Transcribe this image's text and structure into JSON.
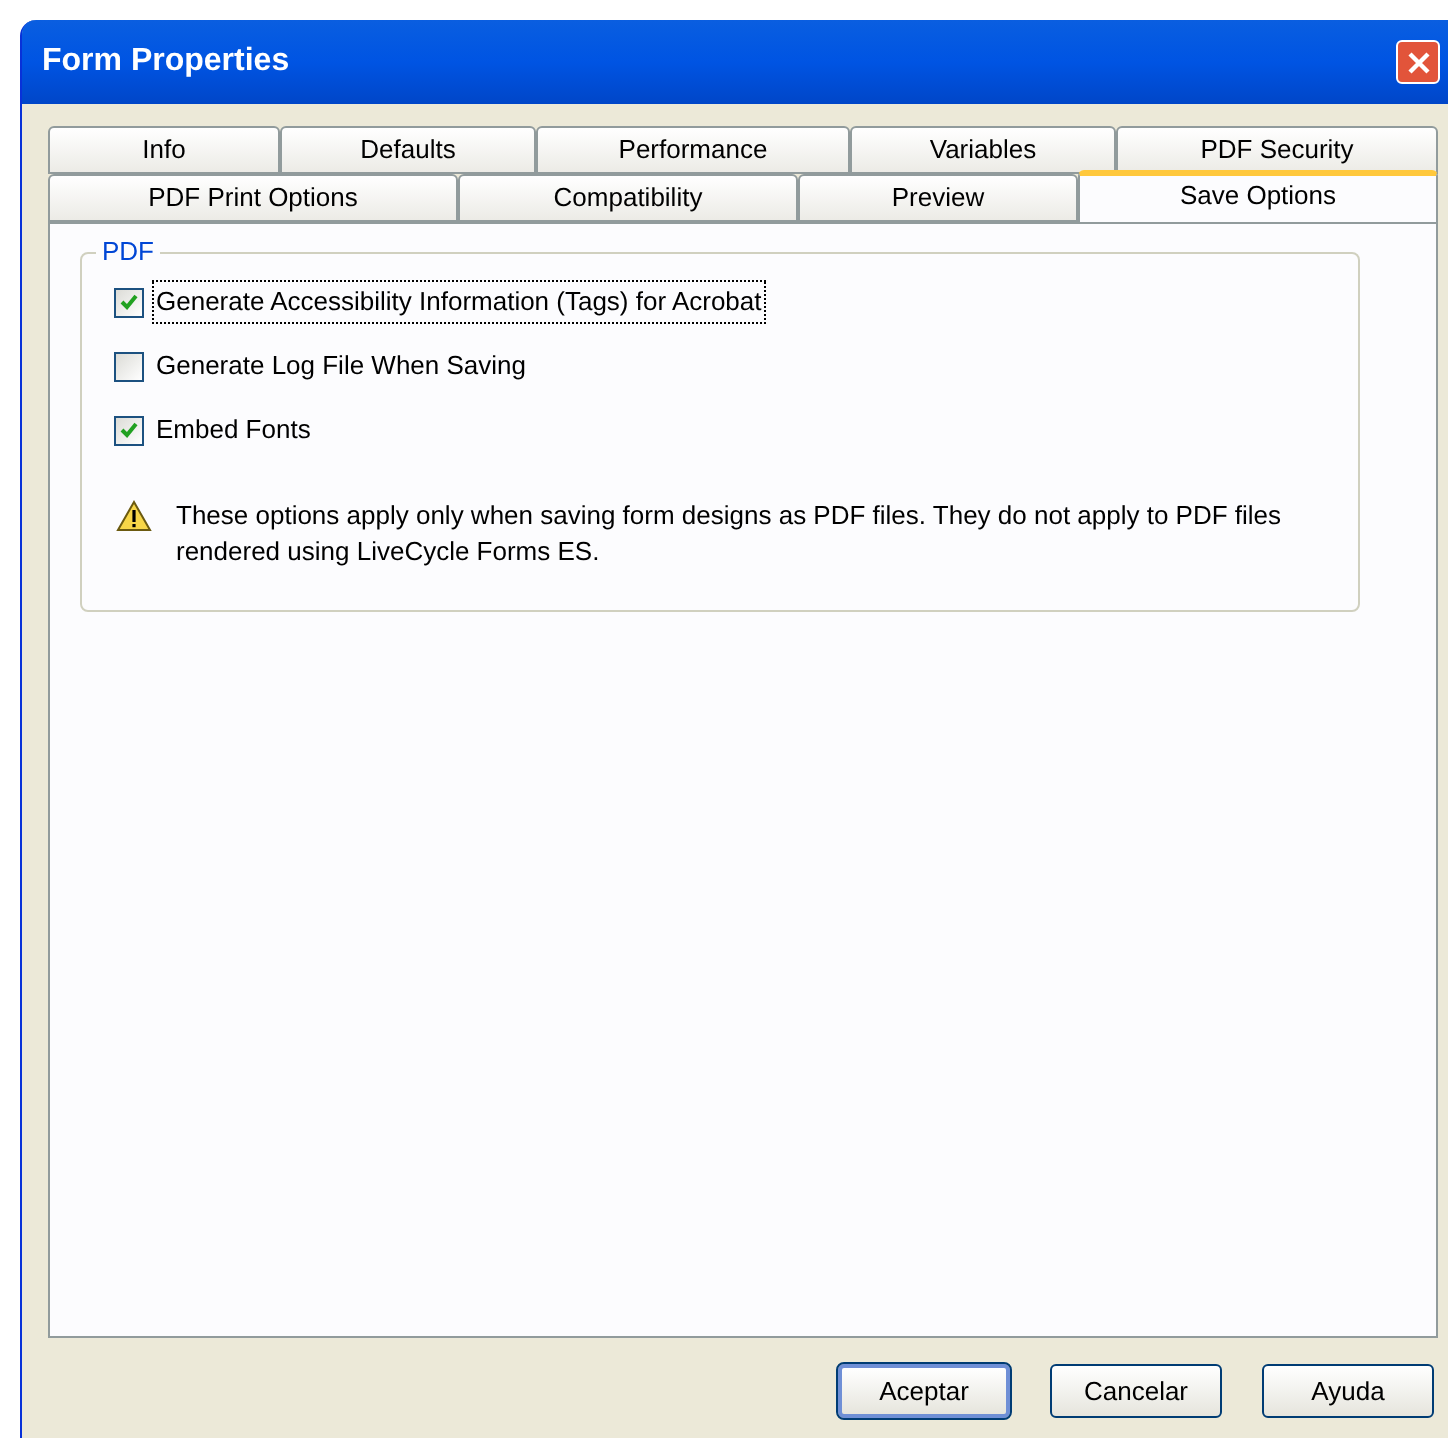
{
  "window": {
    "title": "Form Properties"
  },
  "tab_rows": [
    [
      {
        "label": "Info",
        "selected": false
      },
      {
        "label": "Defaults",
        "selected": false
      },
      {
        "label": "Performance",
        "selected": false
      },
      {
        "label": "Variables",
        "selected": false
      },
      {
        "label": "PDF Security",
        "selected": false
      }
    ],
    [
      {
        "label": "PDF Print Options",
        "selected": false
      },
      {
        "label": "Compatibility",
        "selected": false
      },
      {
        "label": "Preview",
        "selected": false
      },
      {
        "label": "Save Options",
        "selected": true
      }
    ]
  ],
  "group": {
    "title": "PDF",
    "options": [
      {
        "label": "Generate Accessibility Information (Tags) for Acrobat",
        "checked": true
      },
      {
        "label": "Generate Log File When Saving",
        "checked": false
      },
      {
        "label": "Embed Fonts",
        "checked": true
      }
    ],
    "note": "These options apply only when saving form designs as PDF files. They do not apply to PDF files rendered using LiveCycle Forms ES."
  },
  "buttons": [
    {
      "label": "Aceptar",
      "kind": "default"
    },
    {
      "label": "Cancelar",
      "kind": "normal"
    },
    {
      "label": "Ayuda",
      "kind": "normal"
    }
  ]
}
